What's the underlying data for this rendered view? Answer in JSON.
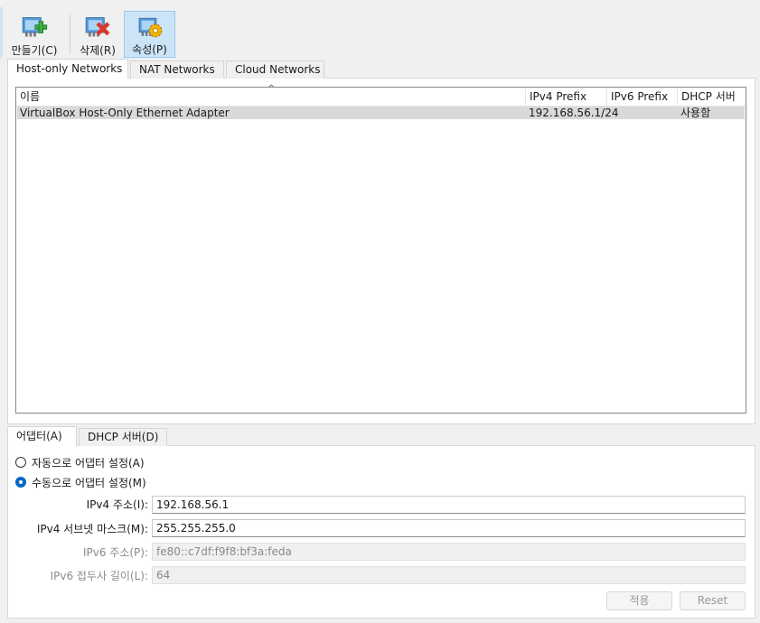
{
  "toolbar": {
    "create_label": "만들기(C)",
    "delete_label": "삭제(R)",
    "properties_label": "속성(P)"
  },
  "tabs": [
    "Host-only Networks",
    "NAT Networks",
    "Cloud Networks"
  ],
  "table": {
    "columns": [
      "이름",
      "IPv4 Prefix",
      "IPv6 Prefix",
      "DHCP 서버"
    ],
    "rows": [
      {
        "name": "VirtualBox Host-Only Ethernet Adapter",
        "ipv4": "192.168.56.1/24",
        "ipv6": "",
        "dhcp": "사용함"
      }
    ]
  },
  "detail_tabs": [
    "어댑터(A)",
    "DHCP 서버(D)"
  ],
  "adapter": {
    "auto_label": "자동으로 어댑터 설정(A)",
    "manual_label": "수동으로 어댑터 설정(M)",
    "ipv4_addr_label": "IPv4 주소(I):",
    "ipv4_addr_value": "192.168.56.1",
    "ipv4_mask_label": "IPv4 서브넷 마스크(M):",
    "ipv4_mask_value": "255.255.255.0",
    "ipv6_addr_label": "IPv6 주소(P):",
    "ipv6_addr_value": "fe80::c7df:f9f8:bf3a:feda",
    "ipv6_prefix_label": "IPv6 접두사 길이(L):",
    "ipv6_prefix_value": "64"
  },
  "buttons": {
    "apply": "적용",
    "reset": "Reset"
  },
  "icons": {
    "create": "network-card-add-icon",
    "delete": "network-card-remove-icon",
    "properties": "network-card-settings-icon"
  },
  "colors": {
    "accent": "#0067c0",
    "selected_toolbar": "#cce4f7",
    "selected_row": "#d9d9d9"
  }
}
